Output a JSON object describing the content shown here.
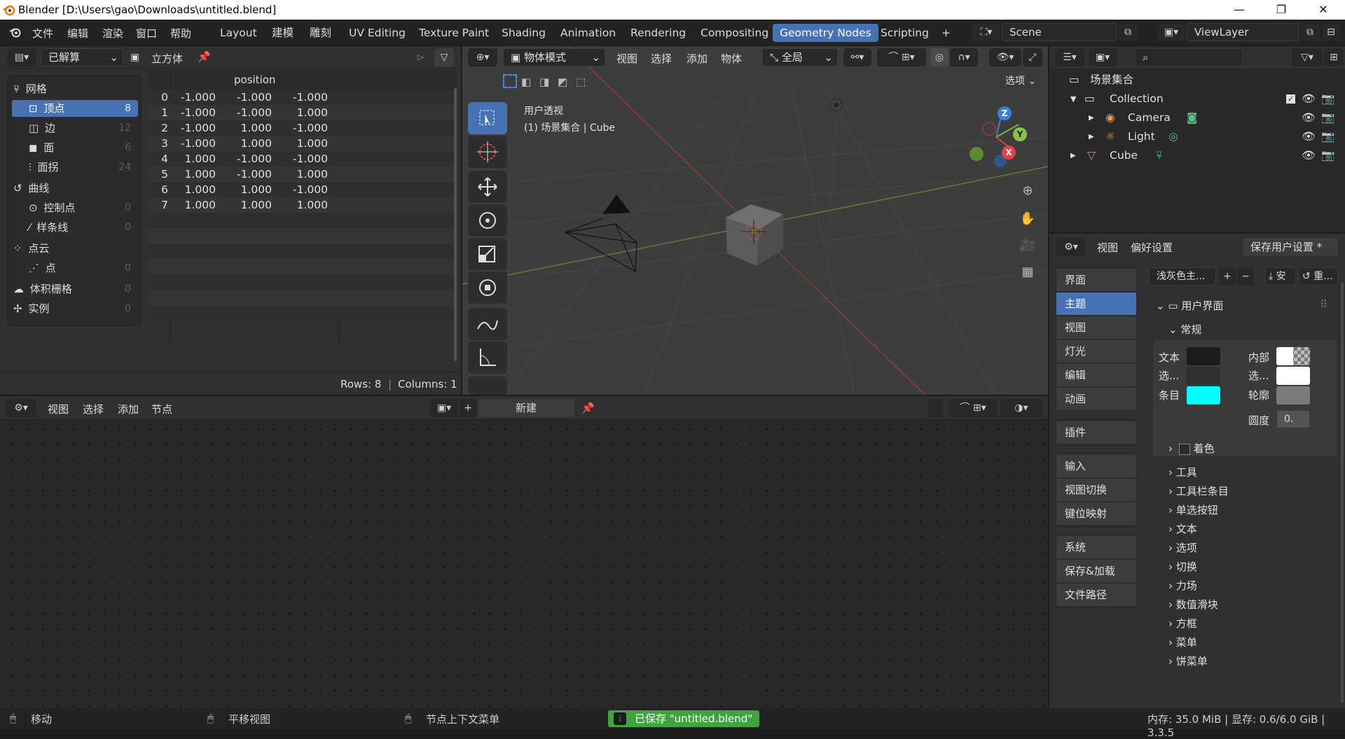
{
  "window": {
    "title": "Blender [D:\\Users\\gao\\Downloads\\untitled.blend]"
  },
  "menu": {
    "file": "文件",
    "edit": "编辑",
    "render": "渲染",
    "window": "窗口",
    "help": "帮助"
  },
  "workspaces": [
    "Layout",
    "建模",
    "雕刻",
    "UV Editing",
    "Texture Paint",
    "Shading",
    "Animation",
    "Rendering",
    "Compositing",
    "Geometry Nodes",
    "Scripting"
  ],
  "active_workspace": "Geometry Nodes",
  "scene": {
    "name": "Scene",
    "view_layer": "ViewLayer"
  },
  "spreadsheet": {
    "eval_mode": "已解算",
    "object_name": "立方体",
    "tree": [
      {
        "label": "网格",
        "count": ""
      },
      {
        "label": "顶点",
        "count": "8"
      },
      {
        "label": "边",
        "count": "12"
      },
      {
        "label": "面",
        "count": "6"
      },
      {
        "label": "面拐",
        "count": "24"
      },
      {
        "label": "曲线",
        "count": ""
      },
      {
        "label": "控制点",
        "count": "0"
      },
      {
        "label": "样条线",
        "count": "0"
      },
      {
        "label": "点云",
        "count": ""
      },
      {
        "label": "点",
        "count": "0"
      },
      {
        "label": "体积栅格",
        "count": "0"
      },
      {
        "label": "实例",
        "count": "0"
      }
    ],
    "column_header": "position",
    "rows": [
      [
        "0",
        "-1.000",
        "-1.000",
        "-1.000"
      ],
      [
        "1",
        "-1.000",
        "-1.000",
        "1.000"
      ],
      [
        "2",
        "-1.000",
        "1.000",
        "-1.000"
      ],
      [
        "3",
        "-1.000",
        "1.000",
        "1.000"
      ],
      [
        "4",
        "1.000",
        "-1.000",
        "-1.000"
      ],
      [
        "5",
        "1.000",
        "-1.000",
        "1.000"
      ],
      [
        "6",
        "1.000",
        "1.000",
        "-1.000"
      ],
      [
        "7",
        "1.000",
        "1.000",
        "1.000"
      ]
    ],
    "status_rows": "Rows: 8",
    "status_cols": "Columns: 1"
  },
  "viewport": {
    "mode": "物体模式",
    "menu": [
      "视图",
      "选择",
      "添加",
      "物体"
    ],
    "orientation": "全局",
    "options": "选项",
    "view_name": "用户透视",
    "view_info": "(1) 场景集合 | Cube",
    "gizmo": {
      "x": "X",
      "y": "Y",
      "z": "Z"
    }
  },
  "node_editor": {
    "menu": [
      "视图",
      "选择",
      "添加",
      "节点"
    ],
    "new_label": "新建"
  },
  "outliner": {
    "root": "场景集合",
    "collection": "Collection",
    "items": [
      "Camera",
      "Light",
      "Cube"
    ]
  },
  "preferences": {
    "header_menu": [
      "视图",
      "偏好设置"
    ],
    "save_label": "保存用户设置 *",
    "nav_groups": [
      [
        "界面",
        "主题",
        "视图",
        "灯光",
        "编辑",
        "动画"
      ],
      [
        "插件"
      ],
      [
        "输入",
        "视图切换",
        "键位映射"
      ],
      [
        "系统",
        "保存&加载",
        "文件路径"
      ]
    ],
    "selected_nav": "主题",
    "preset": "浅灰色主...",
    "install_label": "安",
    "reset_label": "重...",
    "section": "用户界面",
    "subsection": "常规",
    "color_labels_left": [
      "文本",
      "选...",
      "条目"
    ],
    "color_labels_right": [
      "内部",
      "选...",
      "轮廓"
    ],
    "roundness_label": "圆度",
    "roundness_value": "0.",
    "colors": {
      "text": "#1d1d1d",
      "text_sel": "#303030",
      "item": "#00ffff",
      "inner": "#ffffff",
      "inner_sel": "#ffffff",
      "outline": "#7a7a7a"
    },
    "shaded_label": "着色",
    "collapsed": [
      "工具",
      "工具栏条目",
      "单选按钮",
      "文本",
      "选项",
      "切换",
      "力场",
      "数值滑块",
      "方框",
      "菜单",
      "饼菜单"
    ]
  },
  "statusbar": {
    "move": "移动",
    "pan": "平移视图",
    "context_menu": "节点上下文菜单",
    "saved": "已保存 \"untitled.blend\"",
    "stats": "内存: 35.0 MiB | 显存: 0.6/6.0 GiB | 3.3.5"
  },
  "accent_colors": {
    "selection": "#4772b3",
    "saved_bg": "#3fa33f"
  }
}
